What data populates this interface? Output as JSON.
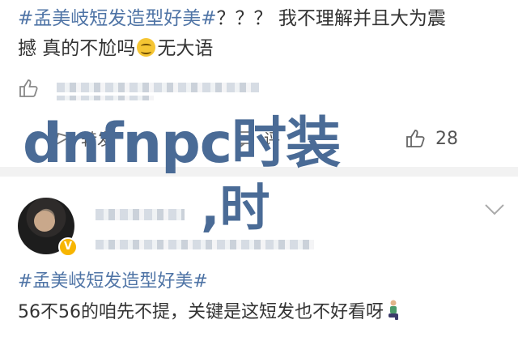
{
  "post": {
    "line1_hashtag": "#孟美岐短发造型好美#",
    "line1_text": "？？？ 我不理解并且大为震",
    "line2_text_before": "撼 真的不尬吗",
    "line2_text_after": "无大语",
    "emoji_name": "grimacing-face-emoji"
  },
  "actions": {
    "share_label": "转发",
    "comment_label": "评",
    "like_count": "28"
  },
  "watermark": {
    "main": "dnfnpc时装",
    "secondary": ",时"
  },
  "comment": {
    "hashtag": "#孟美岐短发造型好美#",
    "text": "56不56的咱先不提，关键是这短发也不好看呀"
  },
  "colors": {
    "hashtag": "#4f74a6",
    "watermark": "#4a6b96",
    "badge": "#f7b500"
  }
}
